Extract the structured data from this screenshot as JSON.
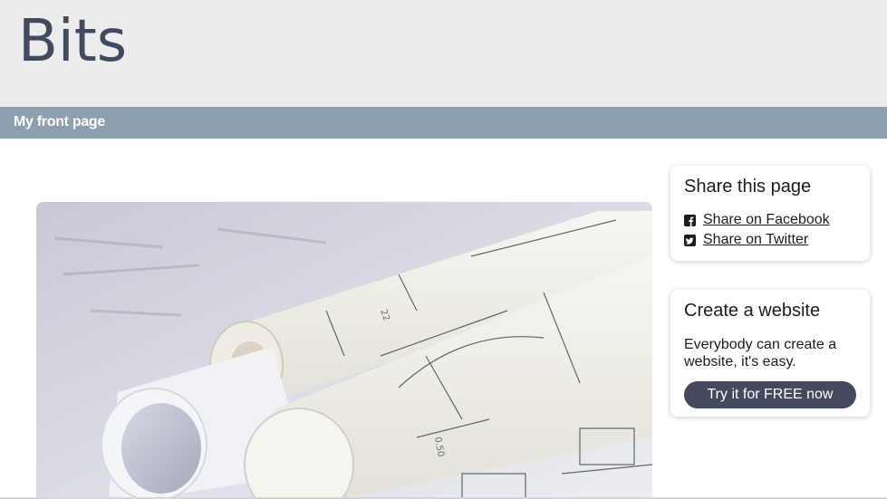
{
  "header": {
    "site_title": "Bits"
  },
  "nav": {
    "items": [
      {
        "label": "My front page"
      }
    ]
  },
  "hero": {
    "image": "architectural-blueprints-rolled"
  },
  "sidebar": {
    "share": {
      "title": "Share this page",
      "links": [
        {
          "label": "Share on Facebook",
          "icon": "facebook-icon"
        },
        {
          "label": "Share on Twitter",
          "icon": "twitter-icon"
        }
      ]
    },
    "create": {
      "title": "Create a website",
      "text": "Everybody can create a website, it's easy.",
      "button_label": "Try it for FREE now"
    }
  },
  "colors": {
    "header_bg": "#ececec",
    "title": "#434a5d",
    "nav_bg": "#8c9fae",
    "button_bg": "#434a5d"
  }
}
